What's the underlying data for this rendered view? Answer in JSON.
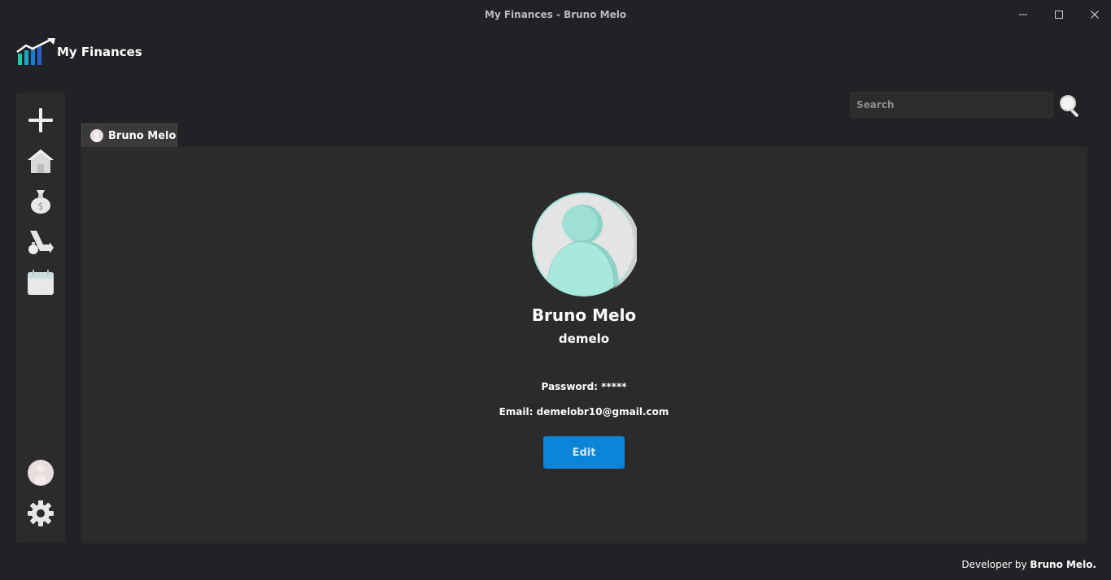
{
  "window": {
    "title": "My Finances - Bruno Melo"
  },
  "app": {
    "name": "My Finances"
  },
  "sidebar": {
    "items": [
      {
        "icon": "plus-icon"
      },
      {
        "icon": "home-icon"
      },
      {
        "icon": "money-bag-icon"
      },
      {
        "icon": "expenses-icon"
      },
      {
        "icon": "calendar-icon"
      },
      {
        "icon": "user-avatar-icon"
      },
      {
        "icon": "gear-icon"
      }
    ]
  },
  "search": {
    "placeholder": "Search",
    "value": ""
  },
  "tab": {
    "label": "Bruno Melo"
  },
  "profile": {
    "name": "Bruno Melo",
    "username": "demelo",
    "password_line": "Password: *****",
    "email_line": "Email: demelobr10@gmail.com",
    "edit_label": "Edit"
  },
  "footer": {
    "prefix": "Developer by ",
    "author": "Bruno Melo."
  },
  "colors": {
    "background": "#202225",
    "panel": "#2b2b2b",
    "accent": "#0a84d6",
    "avatar_teal": "#9fe3da"
  }
}
